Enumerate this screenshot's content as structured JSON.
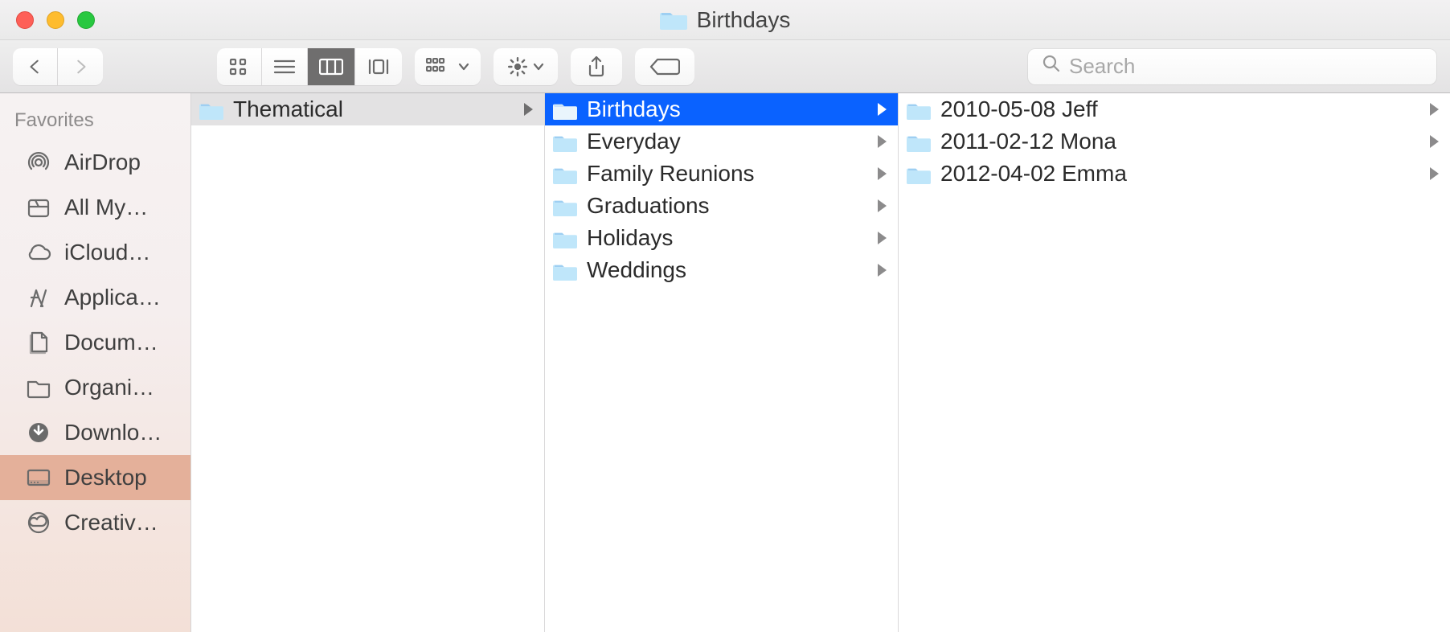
{
  "window": {
    "title": "Birthdays"
  },
  "search": {
    "placeholder": "Search"
  },
  "sidebar": {
    "section": "Favorites",
    "items": [
      {
        "label": "AirDrop"
      },
      {
        "label": "All My…"
      },
      {
        "label": "iCloud…"
      },
      {
        "label": "Applica…"
      },
      {
        "label": "Docum…"
      },
      {
        "label": "Organi…"
      },
      {
        "label": "Downlo…"
      },
      {
        "label": "Desktop"
      },
      {
        "label": "Creativ…"
      }
    ],
    "selected_index": 7
  },
  "columns": [
    {
      "items": [
        {
          "label": "Thematical",
          "has_children": true
        }
      ],
      "selected_index": 0
    },
    {
      "items": [
        {
          "label": "Birthdays",
          "has_children": true
        },
        {
          "label": "Everyday",
          "has_children": true
        },
        {
          "label": "Family Reunions",
          "has_children": true
        },
        {
          "label": "Graduations",
          "has_children": true
        },
        {
          "label": "Holidays",
          "has_children": true
        },
        {
          "label": "Weddings",
          "has_children": true
        }
      ],
      "selected_index": 0
    },
    {
      "items": [
        {
          "label": "2010-05-08 Jeff",
          "has_children": true
        },
        {
          "label": "2011-02-12 Mona",
          "has_children": true
        },
        {
          "label": "2012-04-02 Emma",
          "has_children": true
        }
      ],
      "selected_index": -1
    }
  ]
}
